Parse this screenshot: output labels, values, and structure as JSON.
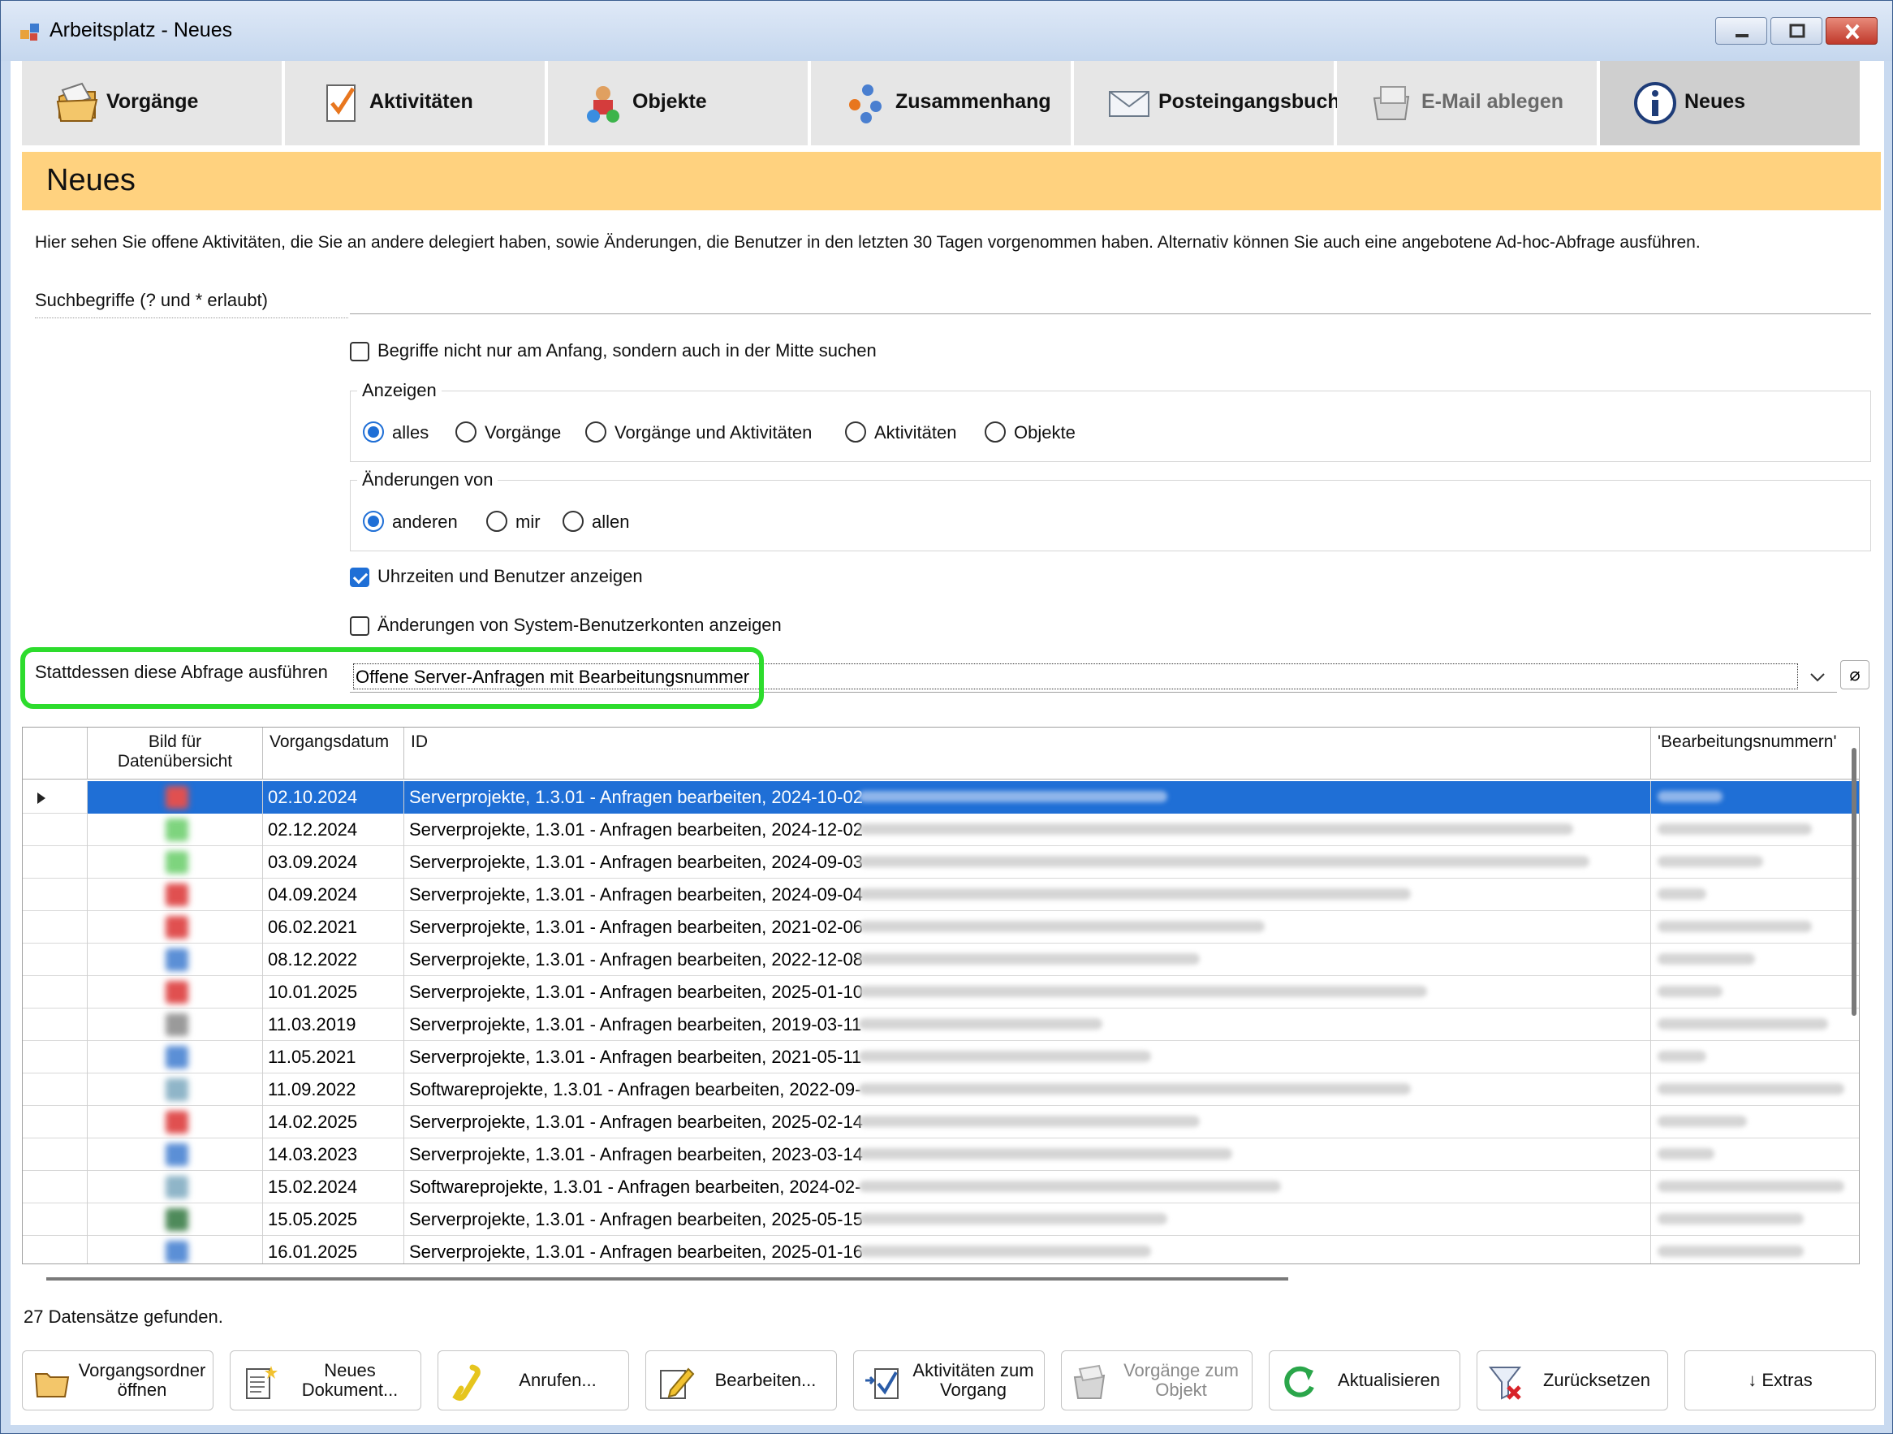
{
  "window": {
    "title": "Arbeitsplatz - Neues"
  },
  "nav": {
    "tabs": [
      {
        "label": "Vorgänge",
        "icon": "folder-open-icon"
      },
      {
        "label": "Aktivitäten",
        "icon": "checklist-icon"
      },
      {
        "label": "Objekte",
        "icon": "objects-icon"
      },
      {
        "label": "Zusammenhang",
        "icon": "network-icon"
      },
      {
        "label": "Posteingangsbuch",
        "icon": "envelope-icon"
      },
      {
        "label": "E-Mail ablegen",
        "icon": "email-file-icon"
      },
      {
        "label": "Neues",
        "icon": "info-icon"
      }
    ],
    "active_tab": "Neues",
    "colors": {
      "header": "#ffd27f",
      "selection": "#1f6fd6",
      "highlight": "#2ddc2d"
    }
  },
  "header": {
    "title": "Neues"
  },
  "intro": "Hier sehen Sie offene Aktivitäten, die Sie an andere delegiert haben, sowie Änderungen, die Benutzer in den letzten 30 Tagen vorgenommen haben. Alternativ können Sie auch eine angebotene Ad-hoc-Abfrage ausführen.",
  "search": {
    "label": "Suchbegriffe (? und * erlaubt)",
    "value": ""
  },
  "options": {
    "middle_search": {
      "label": "Begriffe nicht nur am Anfang, sondern auch in der Mitte suchen",
      "checked": false
    },
    "show_times": {
      "label": "Uhrzeiten und Benutzer anzeigen",
      "checked": true
    },
    "system_accounts": {
      "label": "Änderungen von System-Benutzerkonten anzeigen",
      "checked": false
    }
  },
  "anzeigen": {
    "title": "Anzeigen",
    "choices": [
      "alles",
      "Vorgänge",
      "Vorgänge und Aktivitäten",
      "Aktivitäten",
      "Objekte"
    ],
    "selected": "alles"
  },
  "aenderungen": {
    "title": "Änderungen von",
    "choices": [
      "anderen",
      "mir",
      "allen"
    ],
    "selected": "anderen"
  },
  "query": {
    "label": "Stattdessen diese Abfrage ausführen",
    "value": "Offene Server-Anfragen mit Bearbeitungsnummer",
    "clear_glyph": "⌀"
  },
  "grid": {
    "columns": [
      "Bild für Datenübersicht",
      "Vorgangsdatum",
      "ID",
      "'Bearbeitungsnummern'"
    ],
    "rows": [
      {
        "date": "02.10.2024",
        "id": "Serverprojekte, 1.3.01 - Anfragen bearbeiten, 2024-10-02",
        "thumb": "#e05050",
        "selected": true
      },
      {
        "date": "02.12.2024",
        "id": "Serverprojekte, 1.3.01 - Anfragen bearbeiten, 2024-12-02",
        "thumb": "#7ed47e"
      },
      {
        "date": "03.09.2024",
        "id": "Serverprojekte, 1.3.01 - Anfragen bearbeiten, 2024-09-03",
        "thumb": "#7ed47e"
      },
      {
        "date": "04.09.2024",
        "id": "Serverprojekte, 1.3.01 - Anfragen bearbeiten, 2024-09-04",
        "thumb": "#e05050"
      },
      {
        "date": "06.02.2021",
        "id": "Serverprojekte, 1.3.01 - Anfragen bearbeiten, 2021-02-06",
        "thumb": "#e05050"
      },
      {
        "date": "08.12.2022",
        "id": "Serverprojekte, 1.3.01 - Anfragen bearbeiten, 2022-12-08",
        "thumb": "#5b8fd6"
      },
      {
        "date": "10.01.2025",
        "id": "Serverprojekte, 1.3.01 - Anfragen bearbeiten, 2025-01-10",
        "thumb": "#e05050"
      },
      {
        "date": "11.03.2019",
        "id": "Serverprojekte, 1.3.01 - Anfragen bearbeiten, 2019-03-11",
        "thumb": "#9a9a9a"
      },
      {
        "date": "11.05.2021",
        "id": "Serverprojekte, 1.3.01 - Anfragen bearbeiten, 2021-05-11",
        "thumb": "#5b8fd6"
      },
      {
        "date": "11.09.2022",
        "id": "Softwareprojekte, 1.3.01 - Anfragen bearbeiten, 2022-09-",
        "thumb": "#8fb5c8"
      },
      {
        "date": "14.02.2025",
        "id": "Serverprojekte, 1.3.01 - Anfragen bearbeiten, 2025-02-14",
        "thumb": "#e05050"
      },
      {
        "date": "14.03.2023",
        "id": "Serverprojekte, 1.3.01 - Anfragen bearbeiten, 2023-03-14",
        "thumb": "#5b8fd6"
      },
      {
        "date": "15.02.2024",
        "id": "Softwareprojekte, 1.3.01 - Anfragen bearbeiten, 2024-02-",
        "thumb": "#8fb5c8"
      },
      {
        "date": "15.05.2025",
        "id": "Serverprojekte, 1.3.01 - Anfragen bearbeiten, 2025-05-15",
        "thumb": "#4e8a5a"
      },
      {
        "date": "16.01.2025",
        "id": "Serverprojekte, 1.3.01 - Anfragen bearbeiten, 2025-01-16",
        "thumb": "#5b8fd6"
      }
    ]
  },
  "status": "27 Datensätze gefunden.",
  "buttons": [
    {
      "label": "Vorgangsordner öffnen",
      "icon": "folder-icon"
    },
    {
      "label": "Neues Dokument...",
      "icon": "new-document-icon"
    },
    {
      "label": "Anrufen...",
      "icon": "phone-icon"
    },
    {
      "label": "Bearbeiten...",
      "icon": "edit-icon"
    },
    {
      "label": "Aktivitäten zum Vorgang",
      "icon": "activity-icon"
    },
    {
      "label": "Vorgänge zum Objekt",
      "icon": "folders-icon",
      "disabled": true
    },
    {
      "label": "Aktualisieren",
      "icon": "refresh-icon"
    },
    {
      "label": "Zurücksetzen",
      "icon": "filter-reset-icon"
    },
    {
      "label": "↓ Extras",
      "icon": ""
    }
  ]
}
